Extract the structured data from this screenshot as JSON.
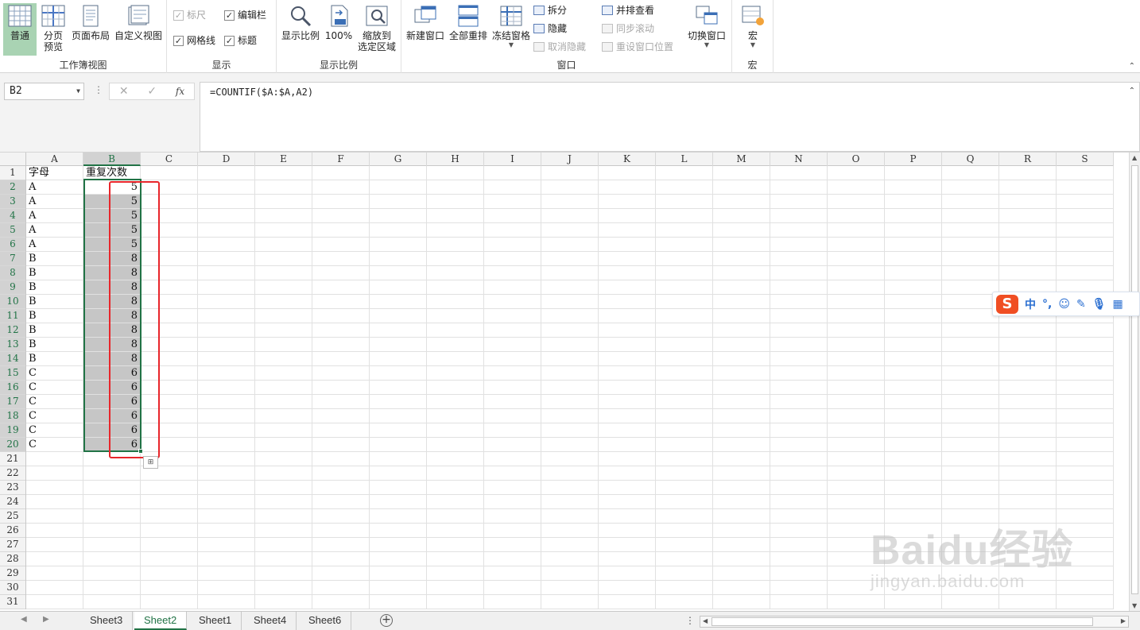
{
  "ribbon": {
    "workbook_views": {
      "label": "工作簿视图",
      "buttons": [
        {
          "label": "普通",
          "active": true
        },
        {
          "label": "分页\n预览"
        },
        {
          "label": "页面布局"
        },
        {
          "label": "自定义视图"
        }
      ]
    },
    "show": {
      "label": "显示",
      "items": [
        {
          "label": "标尺",
          "checked": true,
          "disabled": true
        },
        {
          "label": "编辑栏",
          "checked": true
        },
        {
          "label": "网格线",
          "checked": true
        },
        {
          "label": "标题",
          "checked": true
        }
      ]
    },
    "zoom": {
      "label": "显示比例",
      "buttons": [
        {
          "label": "显示比例"
        },
        {
          "label": "100%"
        },
        {
          "label": "缩放到\n选定区域"
        }
      ]
    },
    "window": {
      "label": "窗口",
      "big": [
        {
          "label": "新建窗口"
        },
        {
          "label": "全部重排"
        },
        {
          "label": "冻结窗格"
        }
      ],
      "small": [
        {
          "label": "拆分",
          "disabled": false
        },
        {
          "label": "隐藏",
          "disabled": false
        },
        {
          "label": "取消隐藏",
          "disabled": true
        },
        {
          "label": "并排查看",
          "disabled": false
        },
        {
          "label": "同步滚动",
          "disabled": true
        },
        {
          "label": "重设窗口位置",
          "disabled": true
        }
      ],
      "switch": {
        "label": "切换窗口"
      }
    },
    "macro": {
      "label": "宏",
      "button": {
        "label": "宏"
      }
    }
  },
  "formula_bar": {
    "name_box": "B2",
    "formula": "=COUNTIF($A:$A,A2)",
    "fx": "fx"
  },
  "columns": [
    "A",
    "B",
    "C",
    "D",
    "E",
    "F",
    "G",
    "H",
    "I",
    "J",
    "K",
    "L",
    "M",
    "N",
    "O",
    "P",
    "Q",
    "R",
    "S"
  ],
  "rows": [
    {
      "n": "1",
      "a": "字母",
      "b": "重复次数"
    },
    {
      "n": "2",
      "a": "A",
      "b": "5"
    },
    {
      "n": "3",
      "a": "A",
      "b": "5"
    },
    {
      "n": "4",
      "a": "A",
      "b": "5"
    },
    {
      "n": "5",
      "a": "A",
      "b": "5"
    },
    {
      "n": "6",
      "a": "A",
      "b": "5"
    },
    {
      "n": "7",
      "a": "B",
      "b": "8"
    },
    {
      "n": "8",
      "a": "B",
      "b": "8"
    },
    {
      "n": "9",
      "a": "B",
      "b": "8"
    },
    {
      "n": "10",
      "a": "B",
      "b": "8"
    },
    {
      "n": "11",
      "a": "B",
      "b": "8"
    },
    {
      "n": "12",
      "a": "B",
      "b": "8"
    },
    {
      "n": "13",
      "a": "B",
      "b": "8"
    },
    {
      "n": "14",
      "a": "B",
      "b": "8"
    },
    {
      "n": "15",
      "a": "C",
      "b": "6"
    },
    {
      "n": "16",
      "a": "C",
      "b": "6"
    },
    {
      "n": "17",
      "a": "C",
      "b": "6"
    },
    {
      "n": "18",
      "a": "C",
      "b": "6"
    },
    {
      "n": "19",
      "a": "C",
      "b": "6"
    },
    {
      "n": "20",
      "a": "C",
      "b": "6"
    },
    {
      "n": "21",
      "a": "",
      "b": ""
    },
    {
      "n": "22",
      "a": "",
      "b": ""
    },
    {
      "n": "23",
      "a": "",
      "b": ""
    },
    {
      "n": "24",
      "a": "",
      "b": ""
    },
    {
      "n": "25",
      "a": "",
      "b": ""
    },
    {
      "n": "26",
      "a": "",
      "b": ""
    },
    {
      "n": "27",
      "a": "",
      "b": ""
    },
    {
      "n": "28",
      "a": "",
      "b": ""
    },
    {
      "n": "29",
      "a": "",
      "b": ""
    },
    {
      "n": "30",
      "a": "",
      "b": ""
    },
    {
      "n": "31",
      "a": "",
      "b": ""
    }
  ],
  "sheets": [
    {
      "label": "Sheet3"
    },
    {
      "label": "Sheet2",
      "active": true
    },
    {
      "label": "Sheet1"
    },
    {
      "label": "Sheet4"
    },
    {
      "label": "Sheet6"
    }
  ],
  "ime": {
    "logo": "S",
    "lang": "中",
    "punct": "°,"
  },
  "watermark": {
    "brand": "Baidu经验",
    "url": "jingyan.baidu.com"
  },
  "colors": {
    "accent": "#217346",
    "highlight": "#e8262b",
    "selection_fill": "#c6c6c6"
  }
}
